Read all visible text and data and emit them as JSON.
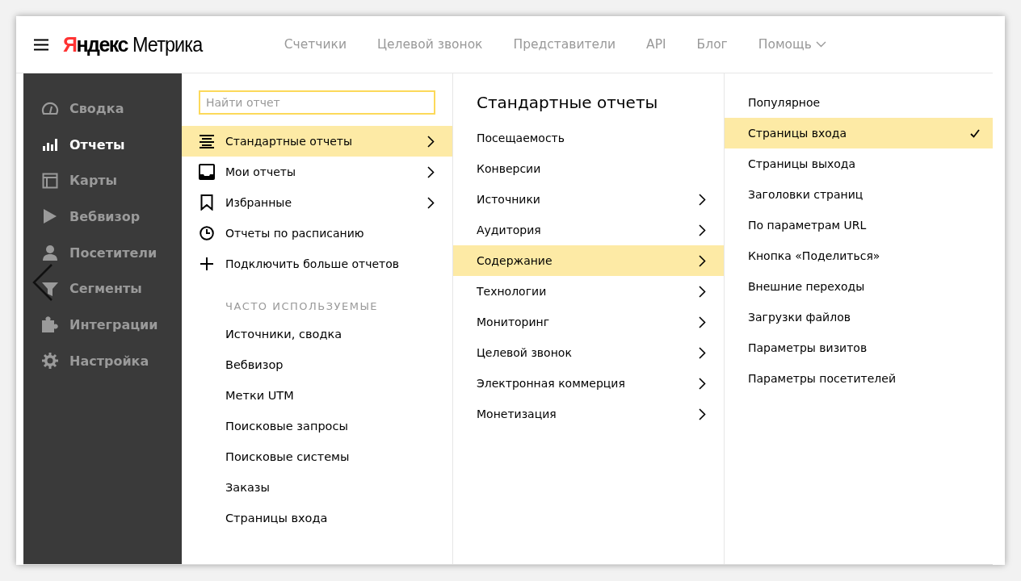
{
  "header": {
    "logo": {
      "brand": "Яндекс",
      "product": "Метрика"
    },
    "nav": [
      {
        "label": "Счетчики",
        "dropdown": false
      },
      {
        "label": "Целевой звонок",
        "dropdown": false
      },
      {
        "label": "Представители",
        "dropdown": false
      },
      {
        "label": "API",
        "dropdown": false
      },
      {
        "label": "Блог",
        "dropdown": false
      },
      {
        "label": "Помощь",
        "dropdown": true
      }
    ]
  },
  "sidebar": {
    "items": [
      {
        "label": "Сводка",
        "kind": "gauge",
        "selected": false
      },
      {
        "label": "Отчеты",
        "kind": "bars",
        "selected": true
      },
      {
        "label": "Карты",
        "kind": "layout",
        "selected": false
      },
      {
        "label": "Вебвизор",
        "kind": "play",
        "selected": false
      },
      {
        "label": "Посетители",
        "kind": "person",
        "selected": false
      },
      {
        "label": "Сегменты",
        "kind": "funnel",
        "selected": false
      },
      {
        "label": "Интеграции",
        "kind": "puzzle",
        "selected": false
      },
      {
        "label": "Настройка",
        "kind": "gear",
        "selected": false
      }
    ]
  },
  "reports_menu": {
    "search": {
      "placeholder": "Найти отчет"
    },
    "items": [
      {
        "label": "Стандартные отчеты",
        "kind": "list",
        "has_children": true,
        "selected": true
      },
      {
        "label": "Мои отчеты",
        "kind": "inbox",
        "has_children": true,
        "selected": false
      },
      {
        "label": "Избранные",
        "kind": "bookmark",
        "has_children": true,
        "selected": false
      },
      {
        "label": "Отчеты по расписанию",
        "kind": "clock",
        "has_children": false,
        "selected": false
      },
      {
        "label": "Подключить больше отчетов",
        "kind": "plus",
        "has_children": false,
        "selected": false
      }
    ],
    "frequent_heading": "ЧАСТО ИСПОЛЬЗУЕМЫЕ",
    "frequent": [
      "Источники, сводка",
      "Вебвизор",
      "Метки UTM",
      "Поисковые запросы",
      "Поисковые системы",
      "Заказы",
      "Страницы входа"
    ]
  },
  "standard_reports": {
    "title": "Стандартные отчеты",
    "items": [
      {
        "label": "Посещаемость",
        "has_children": false,
        "selected": false
      },
      {
        "label": "Конверсии",
        "has_children": false,
        "selected": false
      },
      {
        "label": "Источники",
        "has_children": true,
        "selected": false
      },
      {
        "label": "Аудитория",
        "has_children": true,
        "selected": false
      },
      {
        "label": "Содержание",
        "has_children": true,
        "selected": true
      },
      {
        "label": "Технологии",
        "has_children": true,
        "selected": false
      },
      {
        "label": "Мониторинг",
        "has_children": true,
        "selected": false
      },
      {
        "label": "Целевой звонок",
        "has_children": true,
        "selected": false
      },
      {
        "label": "Электронная коммерция",
        "has_children": true,
        "selected": false
      },
      {
        "label": "Монетизация",
        "has_children": true,
        "selected": false
      }
    ]
  },
  "content_reports": {
    "items": [
      {
        "label": "Популярное",
        "selected": false
      },
      {
        "label": "Страницы входа",
        "selected": true
      },
      {
        "label": "Страницы выхода",
        "selected": false
      },
      {
        "label": "Заголовки страниц",
        "selected": false
      },
      {
        "label": "По параметрам URL",
        "selected": false
      },
      {
        "label": "Кнопка «Поделиться»",
        "selected": false
      },
      {
        "label": "Внешние переходы",
        "selected": false
      },
      {
        "label": "Загрузки файлов",
        "selected": false
      },
      {
        "label": "Параметры визитов",
        "selected": false
      },
      {
        "label": "Параметры посетителей",
        "selected": false
      }
    ]
  }
}
